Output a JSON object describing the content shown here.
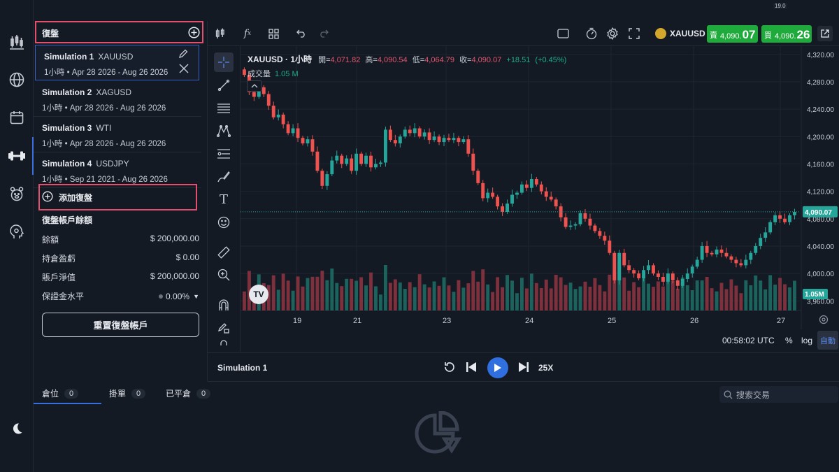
{
  "rail": {
    "items": [
      {
        "icon": "candles-icon"
      },
      {
        "icon": "globe-icon"
      },
      {
        "icon": "calendar-icon"
      },
      {
        "icon": "dumbbell-icon"
      },
      {
        "icon": "bear-icon"
      },
      {
        "icon": "brain-icon"
      }
    ],
    "bottom_icon": "moon-icon"
  },
  "panel": {
    "title": "復盤",
    "simulations": [
      {
        "name": "Simulation 1",
        "symbol": "XAUUSD",
        "detail": "1小時 • Apr 28 2026 - Aug 26 2026"
      },
      {
        "name": "Simulation 2",
        "symbol": "XAGUSD",
        "detail": "1小時 • Apr 28 2026 - Aug 26 2026"
      },
      {
        "name": "Simulation 3",
        "symbol": "WTI",
        "detail": "1小時 • Apr 28 2026 - Aug 26 2026"
      },
      {
        "name": "Simulation 4",
        "symbol": "USDJPY",
        "detail": "1小時 • Sep 21 2021 - Aug 26 2026"
      }
    ],
    "add_label": "添加復盤",
    "account_title": "復盤帳戶餘額",
    "rows": [
      {
        "label": "餘額",
        "value": "$ 200,000.00"
      },
      {
        "label": "持倉盈虧",
        "value": "$ 0.00"
      },
      {
        "label": "賬戶淨值",
        "value": "$ 200,000.00"
      },
      {
        "label": "保證金水平",
        "value": "0.00%"
      }
    ],
    "reset_label": "重置復盤帳戶"
  },
  "toolbar": {
    "symbol": "XAUUSD",
    "sell_label": "賣",
    "sell_price_small": "4,090.",
    "sell_price_big": "07",
    "buy_label": "買",
    "buy_price_small": "4,090.",
    "buy_price_big": "26",
    "spread": "19.0"
  },
  "legend": {
    "title": "XAUUSD · 1小時",
    "open_label": "開=",
    "open": "4,071.82",
    "high_label": "高=",
    "high": "4,090.54",
    "low_label": "低=",
    "low": "4,064.79",
    "close_label": "收=",
    "close": "4,090.07",
    "change": "+18.51",
    "change_pct": "(+0.45%)",
    "volume_label": "成交量",
    "volume": "1.05 M"
  },
  "chart_data": {
    "type": "candlestick",
    "x_tick_labels": [
      "19",
      "21",
      "23",
      "24",
      "25",
      "26",
      "27"
    ],
    "y_ticks": [
      4320,
      4280,
      4240,
      4200,
      4160,
      4120,
      4080,
      4040,
      4000,
      3960
    ],
    "y_tick_labels": [
      "4,320.00",
      "4,280.00",
      "4,240.00",
      "4,200.00",
      "4,160.00",
      "4,120.00",
      "4,080.00",
      "4,040.00",
      "4,000.00",
      "3,960.00"
    ],
    "ylim": [
      3946,
      4332
    ],
    "last_price": 4090.07,
    "last_price_label": "4,090.07",
    "volume_label": "1.05M",
    "up_color": "#26a69a",
    "down_color": "#ef5350",
    "closes": [
      4290,
      4265,
      4258,
      4272,
      4262,
      4245,
      4228,
      4232,
      4218,
      4205,
      4212,
      4198,
      4190,
      4196,
      4178,
      4150,
      4128,
      4145,
      4165,
      4172,
      4160,
      4168,
      4150,
      4175,
      4160,
      4172,
      4155,
      4160,
      4162,
      4210,
      4195,
      4190,
      4200,
      4210,
      4205,
      4212,
      4200,
      4206,
      4195,
      4200,
      4192,
      4198,
      4195,
      4198,
      4192,
      4196,
      4175,
      4150,
      4132,
      4110,
      4118,
      4112,
      4098,
      4090,
      4102,
      4115,
      4118,
      4130,
      4125,
      4138,
      4130,
      4120,
      4112,
      4108,
      4098,
      4082,
      4068,
      4070,
      4072,
      4088,
      4080,
      4070,
      4062,
      4055,
      4048,
      4030,
      3990,
      4030,
      4012,
      4005,
      4000,
      3993,
      4005,
      4012,
      4000,
      3995,
      3988,
      4000,
      3990,
      3982,
      3992,
      4000,
      4010,
      4020,
      4040,
      4030,
      4028,
      4035,
      4030,
      4025,
      4020,
      4015,
      4012,
      4020,
      4030,
      4040,
      4052,
      4060,
      4075,
      4085,
      4080,
      4075,
      4085,
      4090
    ]
  },
  "footer_axis": {
    "time": "00:58:02 UTC",
    "percent": "%",
    "log": "log",
    "auto": "自動"
  },
  "playback": {
    "title": "Simulation 1",
    "speed": "25X"
  },
  "bottom": {
    "tabs": [
      {
        "label": "倉位",
        "count": "0"
      },
      {
        "label": "掛單",
        "count": "0"
      },
      {
        "label": "已平倉",
        "count": "0"
      }
    ],
    "search_placeholder": "搜索交易"
  }
}
